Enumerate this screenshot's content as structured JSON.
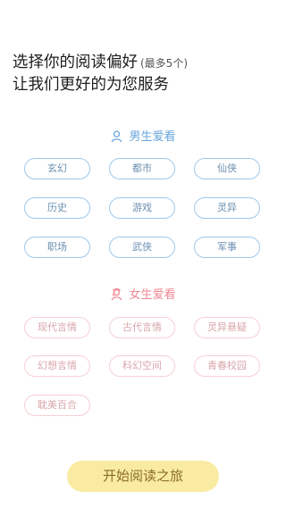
{
  "header": {
    "line1": "选择你的阅读偏好",
    "hint": "(最多5个)",
    "line2": "让我们更好的为您服务"
  },
  "male": {
    "title": "男生爱看",
    "tags": [
      "玄幻",
      "都市",
      "仙侠",
      "历史",
      "游戏",
      "灵异",
      "职场",
      "武侠",
      "军事"
    ]
  },
  "female": {
    "title": "女生爱看",
    "tags": [
      "现代言情",
      "古代言情",
      "灵异悬疑",
      "幻想言情",
      "科幻空间",
      "青春校园",
      "耽美百合"
    ]
  },
  "cta": {
    "label": "开始阅读之旅"
  },
  "colors": {
    "male_accent": "#6aa6dd",
    "female_accent": "#ec8a94",
    "cta_bg": "#faeba2"
  }
}
